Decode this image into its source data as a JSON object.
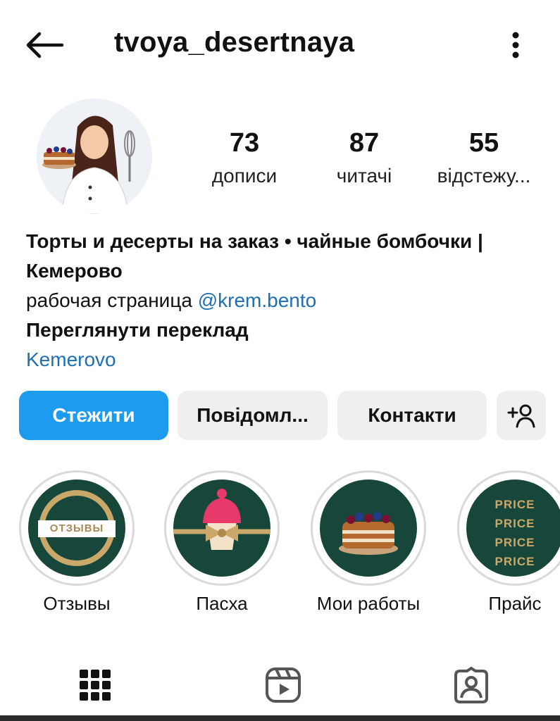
{
  "header": {
    "username": "tvoya_desertnaya",
    "back_icon": "arrow-left-icon",
    "menu_icon": "more-vertical-icon"
  },
  "profile": {
    "avatar_icon": "profile-avatar-illustration",
    "stats": {
      "posts": {
        "count": "73",
        "label": "дописи"
      },
      "followers": {
        "count": "87",
        "label": "читачі"
      },
      "following": {
        "count": "55",
        "label": "відстежу..."
      }
    }
  },
  "bio": {
    "line1": "Торты и десерты на заказ • чайные бомбочки |",
    "line2": "Кемерово",
    "line3_prefix": "рабочая страница ",
    "line3_link": "@krem.bento",
    "translate": "Переглянути переклад",
    "location": "Kemerovo"
  },
  "actions": {
    "follow": "Стежити",
    "message": "Повідомл...",
    "contacts": "Контакти",
    "add_user_icon": "add-person-icon"
  },
  "highlights": [
    {
      "caption": "Отзывы",
      "badge": "ОТЗЫВЫ"
    },
    {
      "caption": "Пасха"
    },
    {
      "caption": "Мои работы"
    },
    {
      "caption": "Прайс",
      "price_lines": [
        "PRICE",
        "PRICE",
        "PRICE",
        "PRICE"
      ]
    }
  ],
  "tabs": {
    "grid_icon": "grid-icon",
    "reels_icon": "reels-icon",
    "tagged_icon": "tagged-person-icon"
  },
  "colors": {
    "accent_blue": "#1c9bef",
    "link_blue": "#1f6fb2",
    "highlight_green": "#17473a",
    "gold": "#c9a86a"
  }
}
